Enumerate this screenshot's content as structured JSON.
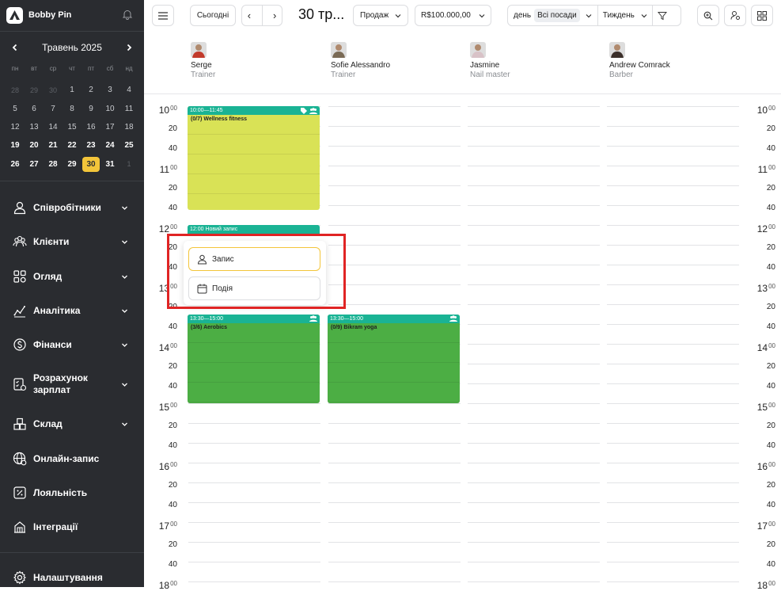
{
  "app": {
    "brand": "Bobby Pin"
  },
  "calendar": {
    "month_label": "Травень 2025",
    "weekdays": [
      "пн",
      "вт",
      "ср",
      "чт",
      "пт",
      "сб",
      "нд"
    ],
    "weeks": [
      [
        "28",
        "29",
        "30",
        "1",
        "2",
        "3",
        "4"
      ],
      [
        "5",
        "6",
        "7",
        "8",
        "9",
        "10",
        "11"
      ],
      [
        "12",
        "13",
        "14",
        "15",
        "16",
        "17",
        "18"
      ],
      [
        "19",
        "20",
        "21",
        "22",
        "23",
        "24",
        "25"
      ],
      [
        "26",
        "27",
        "28",
        "29",
        "30",
        "31",
        "1"
      ]
    ],
    "selected": "30"
  },
  "nav": [
    {
      "label": "Співробітники",
      "icon": "person-icon",
      "has_chevron": true
    },
    {
      "label": "Клієнти",
      "icon": "clients-icon",
      "has_chevron": true
    },
    {
      "label": "Огляд",
      "icon": "overview-icon",
      "has_chevron": true
    },
    {
      "label": "Аналітика",
      "icon": "analytics-icon",
      "has_chevron": true
    },
    {
      "label": "Фінанси",
      "icon": "finance-icon",
      "has_chevron": true
    },
    {
      "label": "Розрахунок зарплат",
      "icon": "payroll-icon",
      "has_chevron": true
    },
    {
      "label": "Склад",
      "icon": "warehouse-icon",
      "has_chevron": true
    },
    {
      "label": "Онлайн-запис",
      "icon": "globe-icon",
      "has_chevron": false
    },
    {
      "label": "Лояльність",
      "icon": "percent-icon",
      "has_chevron": false
    },
    {
      "label": "Інтеграції",
      "icon": "integrations-icon",
      "has_chevron": false
    },
    {
      "label": "Налаштування",
      "icon": "gear-icon",
      "has_chevron": false
    }
  ],
  "toolbar": {
    "today_label": "Сьогодні",
    "prev": "‹",
    "next": "›",
    "date_title": "30 тр...",
    "sales_label": "Продаж",
    "amount_label": "R$100.000,00",
    "day_label": "день",
    "positions_label": "Всі посади",
    "week_label": "Тиждень"
  },
  "staff": [
    {
      "name": "Serge",
      "role": "Trainer",
      "avatar_color": "#c23a2b"
    },
    {
      "name": "Sofie Alessandro",
      "role": "Trainer",
      "avatar_color": "#7a6a55"
    },
    {
      "name": "Jasmine",
      "role": "Nail master",
      "avatar_color": "#d8c2c7"
    },
    {
      "name": "Andrew Comrack",
      "role": "Barber",
      "avatar_color": "#3b2f2a"
    }
  ],
  "time_rows": [
    {
      "h": "10",
      "m": "00"
    },
    {
      "m": "20"
    },
    {
      "m": "40"
    },
    {
      "h": "11",
      "m": "00"
    },
    {
      "m": "20"
    },
    {
      "m": "40"
    },
    {
      "h": "12",
      "m": "00"
    },
    {
      "m": "20"
    },
    {
      "m": "40"
    },
    {
      "h": "13",
      "m": "00"
    },
    {
      "m": "20"
    },
    {
      "m": "40"
    },
    {
      "h": "14",
      "m": "00"
    },
    {
      "m": "20"
    },
    {
      "m": "40"
    },
    {
      "h": "15",
      "m": "00"
    },
    {
      "m": "20"
    },
    {
      "m": "40"
    },
    {
      "h": "16",
      "m": "00"
    },
    {
      "m": "20"
    },
    {
      "m": "40"
    },
    {
      "h": "17",
      "m": "00"
    },
    {
      "m": "20"
    },
    {
      "m": "40"
    },
    {
      "h": "18",
      "m": "00"
    }
  ],
  "events": [
    {
      "time": "10:00—11:45",
      "title": "(0/7) Wellness fitness",
      "color": "#d9e256",
      "col": 0,
      "start": "10:00",
      "end": "11:45"
    },
    {
      "time": "12:00 Новий запис",
      "title": "",
      "color": "#1ab394",
      "col": 0,
      "start": "12:00",
      "end": "12:10"
    },
    {
      "time": "13:30—15:00",
      "title": "(3/6) Aerobics",
      "color": "#4cae44",
      "col": 0,
      "start": "13:30",
      "end": "15:00"
    },
    {
      "time": "13:30—15:00",
      "title": "(0/9) Bikram yoga",
      "color": "#4cae44",
      "col": 1,
      "start": "13:30",
      "end": "15:00"
    }
  ],
  "popup": {
    "items": [
      {
        "label": "Запис",
        "icon": "user-icon"
      },
      {
        "label": "Подія",
        "icon": "calendar-icon"
      }
    ]
  }
}
